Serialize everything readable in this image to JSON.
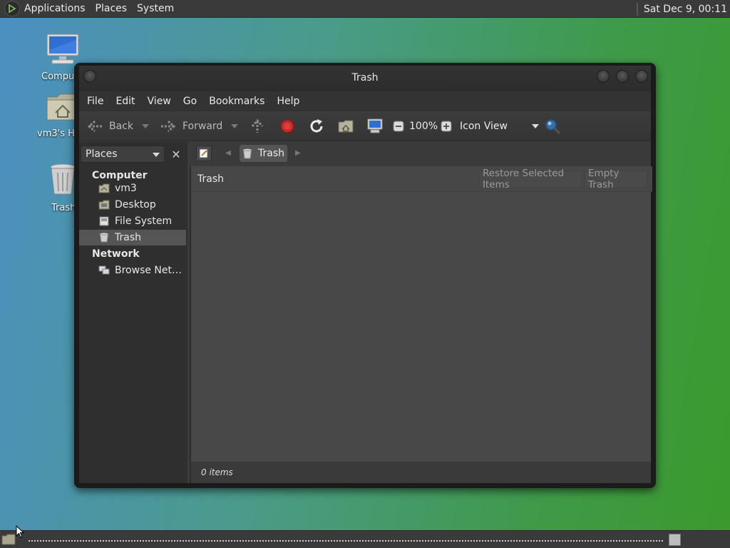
{
  "top_panel": {
    "menus": [
      "Applications",
      "Places",
      "System"
    ],
    "clock": "Sat Dec  9, 00:11"
  },
  "desktop_icons": [
    {
      "label": "Compu",
      "icon": "computer-icon"
    },
    {
      "label": "vm3's Ho",
      "icon": "home-folder-icon"
    },
    {
      "label": "Trash",
      "icon": "trash-icon"
    }
  ],
  "window": {
    "title": "Trash",
    "menu": [
      "File",
      "Edit",
      "View",
      "Go",
      "Bookmarks",
      "Help"
    ],
    "toolbar": {
      "back": "Back",
      "forward": "Forward",
      "zoom": "100%",
      "view_mode": "Icon View"
    },
    "sidebar": {
      "selector": "Places",
      "computer_header": "Computer",
      "computer_items": [
        "vm3",
        "Desktop",
        "File System",
        "Trash"
      ],
      "network_header": "Network",
      "network_items": [
        "Browse Net…"
      ],
      "selected": "Trash"
    },
    "location": {
      "crumb": "Trash"
    },
    "info_bar": {
      "title": "Trash",
      "restore_button": "Restore Selected Items",
      "empty_button": "Empty Trash"
    },
    "status": "0 items"
  },
  "colors": {
    "panel": "#3a3a3a",
    "window_bg": "#3c3c3c",
    "sidebar_bg": "#2f2f2f",
    "stop_red": "#c62828",
    "selection": "#555555"
  }
}
